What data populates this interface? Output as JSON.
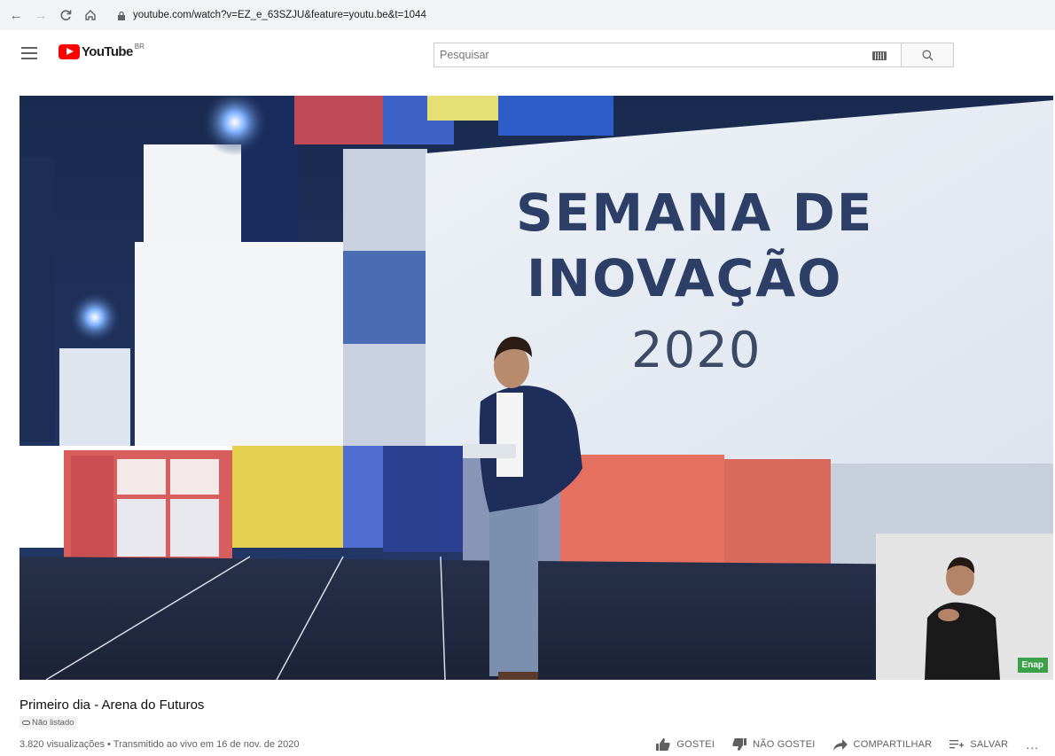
{
  "browser": {
    "url": "youtube.com/watch?v=EZ_e_63SZJU&feature=youtu.be&t=1044"
  },
  "header": {
    "logo_text": "YouTube",
    "region": "BR",
    "search_placeholder": "Pesquisar"
  },
  "video": {
    "slide_line1": "SEMANA DE",
    "slide_line2": "INOVAÇÃO",
    "slide_year": "2020",
    "watermark": "Enap"
  },
  "info": {
    "title": "Primeiro dia - Arena do Futuros",
    "badge": "Não listado",
    "meta": "3.820 visualizações • Transmitido ao vivo em 16 de nov. de 2020"
  },
  "actions": {
    "like": "GOSTEI",
    "dislike": "NÃO GOSTEI",
    "share": "COMPARTILHAR",
    "save": "SALVAR",
    "more": "..."
  }
}
